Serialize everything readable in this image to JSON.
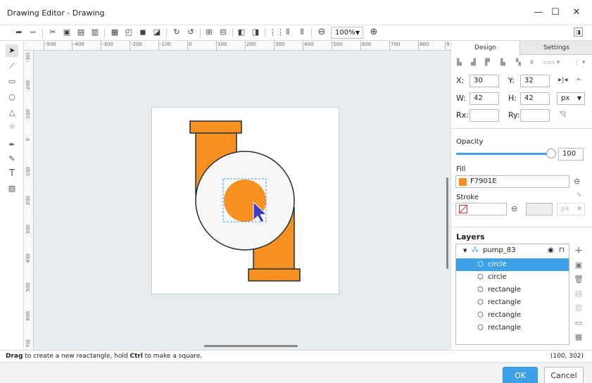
{
  "window": {
    "title": "Drawing Editor - Drawing",
    "minimize": "—",
    "maximize": "☐",
    "close": "✕"
  },
  "toolbar": {
    "zoom_value": "100%"
  },
  "hruler_labels": [
    "-500",
    "-400",
    "-300",
    "-200",
    "-100",
    "0",
    "100",
    "200",
    "300",
    "400",
    "500",
    "600",
    "700",
    "800",
    "9"
  ],
  "vruler_labels": [
    "-30(",
    "-200",
    "-100",
    "0",
    "100",
    "200",
    "300",
    "400",
    "500",
    "600",
    "70("
  ],
  "tabs": {
    "design": "Design",
    "settings": "Settings"
  },
  "geometry": {
    "x_label": "X:",
    "x_value": "30",
    "y_label": "Y:",
    "y_value": "32",
    "w_label": "W:",
    "w_value": "42",
    "h_label": "H:",
    "h_value": "42",
    "unit": "px",
    "rx_label": "Rx:",
    "rx_value": "",
    "ry_label": "Ry:",
    "ry_value": ""
  },
  "opacity": {
    "label": "Opacity",
    "value": "100",
    "fraction": 1.0
  },
  "fill": {
    "label": "Fill",
    "value": "F7901E",
    "color": "#F7901E"
  },
  "stroke": {
    "label": "Stroke",
    "value": "",
    "unit": "px"
  },
  "layers": {
    "title": "Layers",
    "group": "pump_83",
    "items": [
      {
        "label": "circle",
        "selected": true
      },
      {
        "label": "circle",
        "selected": false
      },
      {
        "label": "rectangle",
        "selected": false
      },
      {
        "label": "rectangle",
        "selected": false
      },
      {
        "label": "rectangle",
        "selected": false
      },
      {
        "label": "rectangle",
        "selected": false
      }
    ]
  },
  "status": {
    "msg_bold1": "Drag",
    "msg_text1": " to create a new reactangle, hold ",
    "msg_bold2": "Ctrl",
    "msg_text2": " to make a square.",
    "coords": "(100, 302)"
  },
  "buttons": {
    "ok": "OK",
    "cancel": "Cancel"
  },
  "colors": {
    "accent": "#3ea0e6",
    "pump_orange": "#F7901E",
    "outline": "#1f2d3d"
  }
}
